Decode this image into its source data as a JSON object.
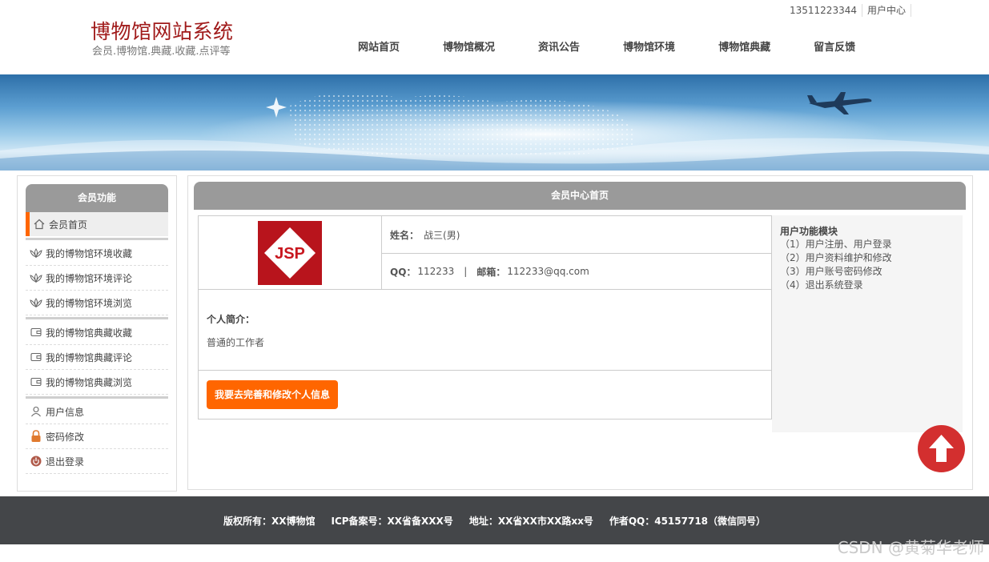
{
  "header": {
    "phone": "13511223344",
    "user_center": "用户中心",
    "site_title": "博物馆网站系统",
    "site_subtitle": "会员.博物馆.典藏.收藏.点评等"
  },
  "nav": {
    "items": [
      {
        "label": "网站首页"
      },
      {
        "label": "博物馆概况"
      },
      {
        "label": "资讯公告"
      },
      {
        "label": "博物馆环境"
      },
      {
        "label": "博物馆典藏"
      },
      {
        "label": "留言反馈"
      }
    ]
  },
  "sidebar": {
    "title": "会员功能",
    "home": "会员首页",
    "env_items": [
      {
        "label": "我的博物馆环境收藏"
      },
      {
        "label": "我的博物馆环境评论"
      },
      {
        "label": "我的博物馆环境浏览"
      }
    ],
    "collection_items": [
      {
        "label": "我的博物馆典藏收藏"
      },
      {
        "label": "我的博物馆典藏评论"
      },
      {
        "label": "我的博物馆典藏浏览"
      }
    ],
    "account_items": [
      {
        "label": "用户信息"
      },
      {
        "label": "密码修改"
      },
      {
        "label": "退出登录"
      }
    ]
  },
  "main": {
    "title": "会员中心首页",
    "avatar_text": "JSP",
    "name_label": "姓名：",
    "name_value": "战三(男)",
    "qq_label": "QQ：",
    "qq_value": "112233",
    "separator": "|",
    "email_label": "邮箱：",
    "email_value": "112233@qq.com",
    "bio_label": "个人简介：",
    "bio_text": "普通的工作者",
    "edit_button": "我要去完善和修改个人信息"
  },
  "functions": {
    "title": "用户功能模块",
    "items": [
      {
        "label": "（1）用户注册、用户登录"
      },
      {
        "label": "（2）用户资料维护和修改"
      },
      {
        "label": "（3）用户账号密码修改"
      },
      {
        "label": "（4）退出系统登录"
      }
    ]
  },
  "footer": {
    "copyright": "版权所有：XX博物馆",
    "icp": "ICP备案号：XX省备XXX号",
    "address": "地址：XX省XX市XX路xx号",
    "author": "作者QQ：45157718（微信同号）"
  },
  "watermark": "CSDN @黄菊华老师",
  "colors": {
    "accent": "#ff6600",
    "title_red": "#a01a1a",
    "header_gray": "#9a9a9a",
    "footer_bg": "#444649",
    "back_top": "#d32f2f"
  }
}
